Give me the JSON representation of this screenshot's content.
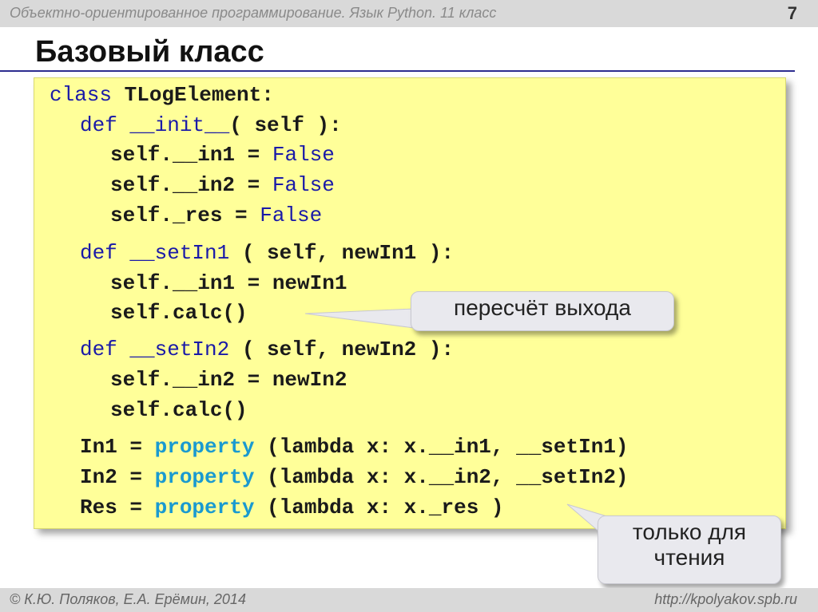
{
  "header": {
    "course": "Объектно-ориентированное программирование. Язык Python. 11 класс",
    "slide_number": "7"
  },
  "title": "Базовый класс",
  "code": {
    "l1_kw": "class",
    "l1_rest": " TLogElement:",
    "l2_kw": "def",
    "l2_name": " __init__",
    "l2_rest": "( self ):",
    "l3_lhs": "self.__in1",
    "l3_eq": " = ",
    "l3_rhs": "False",
    "l4_lhs": "self.__in2",
    "l4_eq": " = ",
    "l4_rhs": "False",
    "l5_lhs": "self._res",
    "l5_eq": " = ",
    "l5_rhs": "False",
    "l6_kw": "def",
    "l6_name": " __setIn1",
    "l6_rest": " ( self, newIn1 ):",
    "l7": "self.__in1 = newIn1",
    "l8": "self.calc()",
    "l9_kw": "def",
    "l9_name": " __setIn2",
    "l9_rest": " ( self, newIn2 ):",
    "l10": "self.__in2 = newIn2",
    "l11": "self.calc()",
    "l12_lhs": "In1",
    "l12_eq": " = ",
    "l12_fn": "property",
    "l12_rest": " (lambda x: x.__in1, __setIn1)",
    "l13_lhs": "In2",
    "l13_eq": " = ",
    "l13_fn": "property",
    "l13_rest": " (lambda x: x.__in2, __setIn2)",
    "l14_lhs": "Res",
    "l14_eq": " = ",
    "l14_fn": "property",
    "l14_rest": " (lambda x: x._res )"
  },
  "callouts": {
    "recalc": "пересчёт выхода",
    "readonly_line1": "только для",
    "readonly_line2": "чтения"
  },
  "footer": {
    "authors": "© К.Ю. Поляков, Е.А. Ерёмин, 2014",
    "url": "http://kpolyakov.spb.ru"
  },
  "colors": {
    "code_background": "#ffff99",
    "keyword": "#1a1aa8",
    "builtin": "#1a9ad0",
    "title_rule": "#2d2d8f"
  }
}
